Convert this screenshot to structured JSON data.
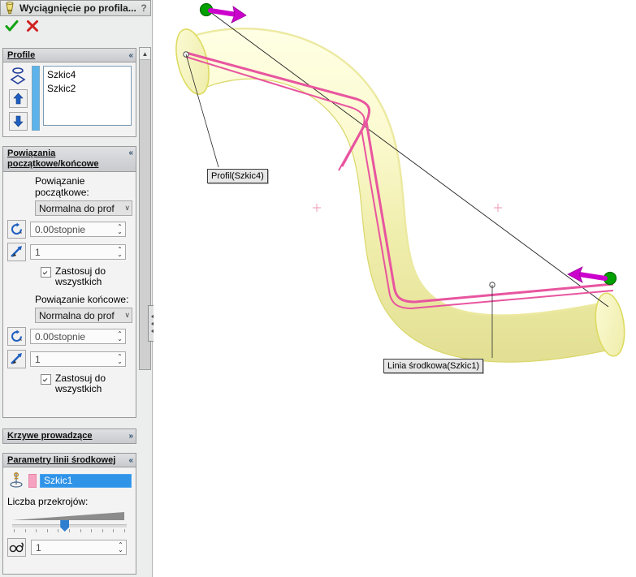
{
  "window": {
    "title": "Wyciągnięcie po profila...",
    "icon": "loft-icon",
    "help_label": "?",
    "accept_label": "✔",
    "cancel_label": "✘"
  },
  "panels": {
    "profile": {
      "title": "Profile",
      "collapse_glyph": "«",
      "items": [
        "Szkic4",
        "Szkic2"
      ],
      "move_up_label": "↑",
      "move_down_label": "↓"
    },
    "start_end_constraints": {
      "title_line1": "Powiązania",
      "title_line2": "początkowe/końcowe",
      "collapse_glyph": "«",
      "start_label": "Powiązanie początkowe:",
      "start_dropdown": "Normalna do prof",
      "start_angle": "0.00stopnie",
      "start_tangent": "1",
      "start_apply_all": "Zastosuj do wszystkich",
      "start_apply_all_checked": true,
      "end_label": "Powiązanie końcowe:",
      "end_dropdown": "Normalna do prof",
      "end_angle": "0.00stopnie",
      "end_tangent": "1",
      "end_apply_all": "Zastosuj do wszystkich",
      "end_apply_all_checked": true,
      "dropdown_arrow": "∨",
      "spinner_up": "⌃",
      "spinner_down": "⌄"
    },
    "guide_curves": {
      "title": "Krzywe prowadzące",
      "collapse_glyph": "»"
    },
    "centerline_parameters": {
      "title": "Parametry linii środkowej",
      "collapse_glyph": "«",
      "selection": "Szkic1",
      "sections_label": "Liczba przekrojów:",
      "sections_value": "1",
      "preview_icon": "glasses-icon",
      "swatch_color": "#f7a2c0",
      "selection_bg": "#2f93e8"
    }
  },
  "canvas": {
    "labels": {
      "profile": "Profil(Szkic4)",
      "centerline": "Linia środkowa(Szkic1)"
    },
    "colors": {
      "solid_fill": "#f2f0b8",
      "solid_edge": "#d8d65e",
      "sketch": "#e8559f",
      "handle": "#cc00cc",
      "endpoint": "#00a000"
    }
  }
}
